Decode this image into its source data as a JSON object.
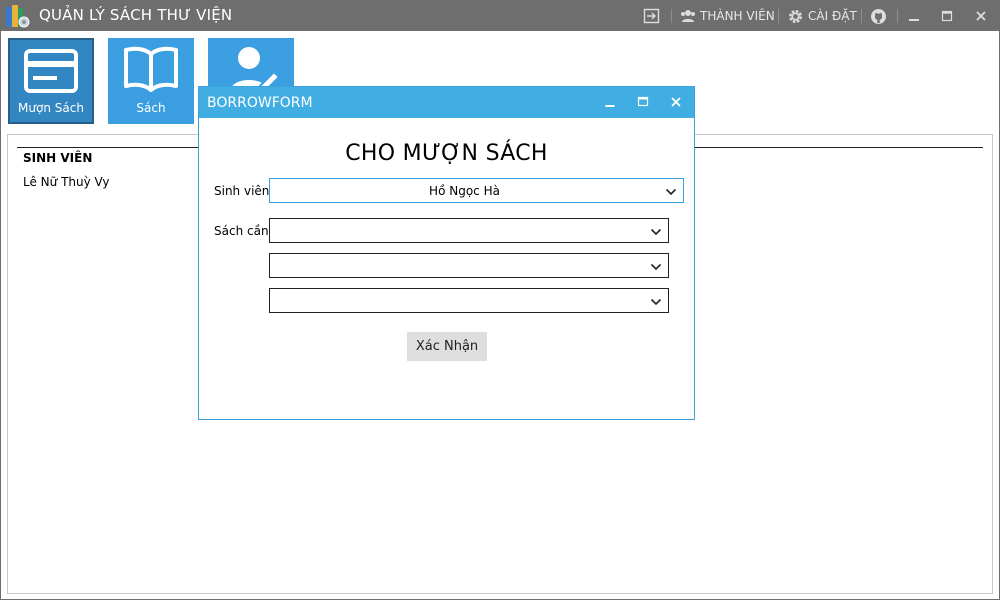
{
  "app": {
    "title": "QUẢN LÝ SÁCH THƯ VIỆN",
    "members_label": "THÀNH VIÊN",
    "settings_label": "CÀI ĐẶT"
  },
  "tiles": [
    {
      "label": "Mượn Sách",
      "icon": "card-icon"
    },
    {
      "label": "Sách",
      "icon": "book-icon"
    },
    {
      "label": "",
      "icon": "user-edit-icon"
    }
  ],
  "table": {
    "header": "SINH VIÊN",
    "rows": [
      "Lê Nữ Thuỳ Vy"
    ]
  },
  "dialog": {
    "title": "BORROWFORM",
    "heading": "CHO MƯỢN SÁCH",
    "student_label": "Sinh viên:",
    "student_value": "Hồ Ngọc Hà",
    "books_label": "Sách cần",
    "book_values": [
      "",
      "",
      ""
    ],
    "confirm_label": "Xác Nhận"
  },
  "colors": {
    "titlebar": "#6e6e6e",
    "tile": "#3b9ee0",
    "dialog_titlebar": "#40aee3"
  }
}
